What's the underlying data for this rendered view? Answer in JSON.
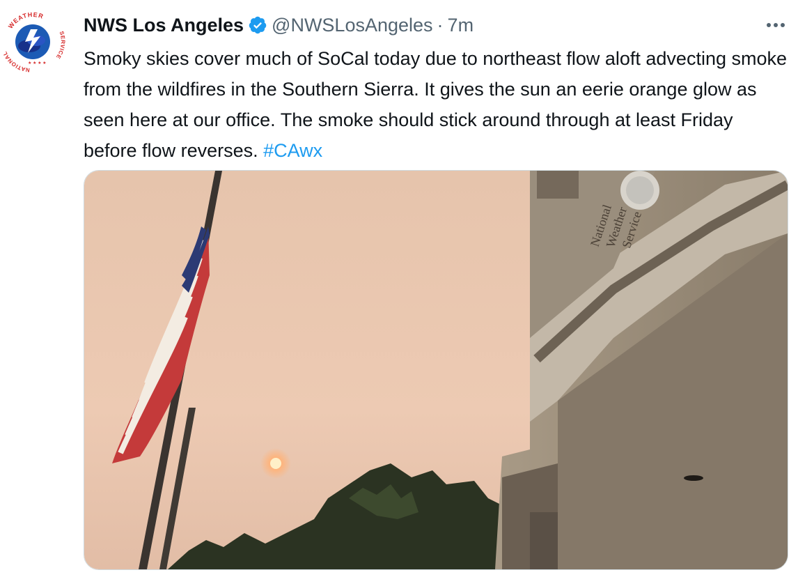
{
  "tweet": {
    "author_name": "NWS Los Angeles",
    "handle": "@NWSLosAngeles",
    "separator": "·",
    "time": "7m",
    "more_label": "···",
    "text": "Smoky skies cover much of SoCal today due to northeast flow aloft advecting smoke from the wildfires in the Southern Sierra. It gives the sun an eerie orange glow as seen here at our office. The smoke should stick around through at least Friday before flow reverses.",
    "hashtag": "#CAwx"
  },
  "avatar": {
    "ring_text_top": "WEATHER",
    "ring_text_left": "NATIONAL",
    "ring_text_right": "SERVICE"
  },
  "photo": {
    "sign_lines": [
      "National",
      "Weather",
      "Service"
    ]
  },
  "colors": {
    "accent": "#1d9bf0",
    "text": "#0f1419",
    "muted": "#536471",
    "sky": "#e9c9b0",
    "sun": "#ffb27a"
  },
  "icons": {
    "verified": "verified-badge-icon",
    "more": "more-horizontal-icon"
  }
}
